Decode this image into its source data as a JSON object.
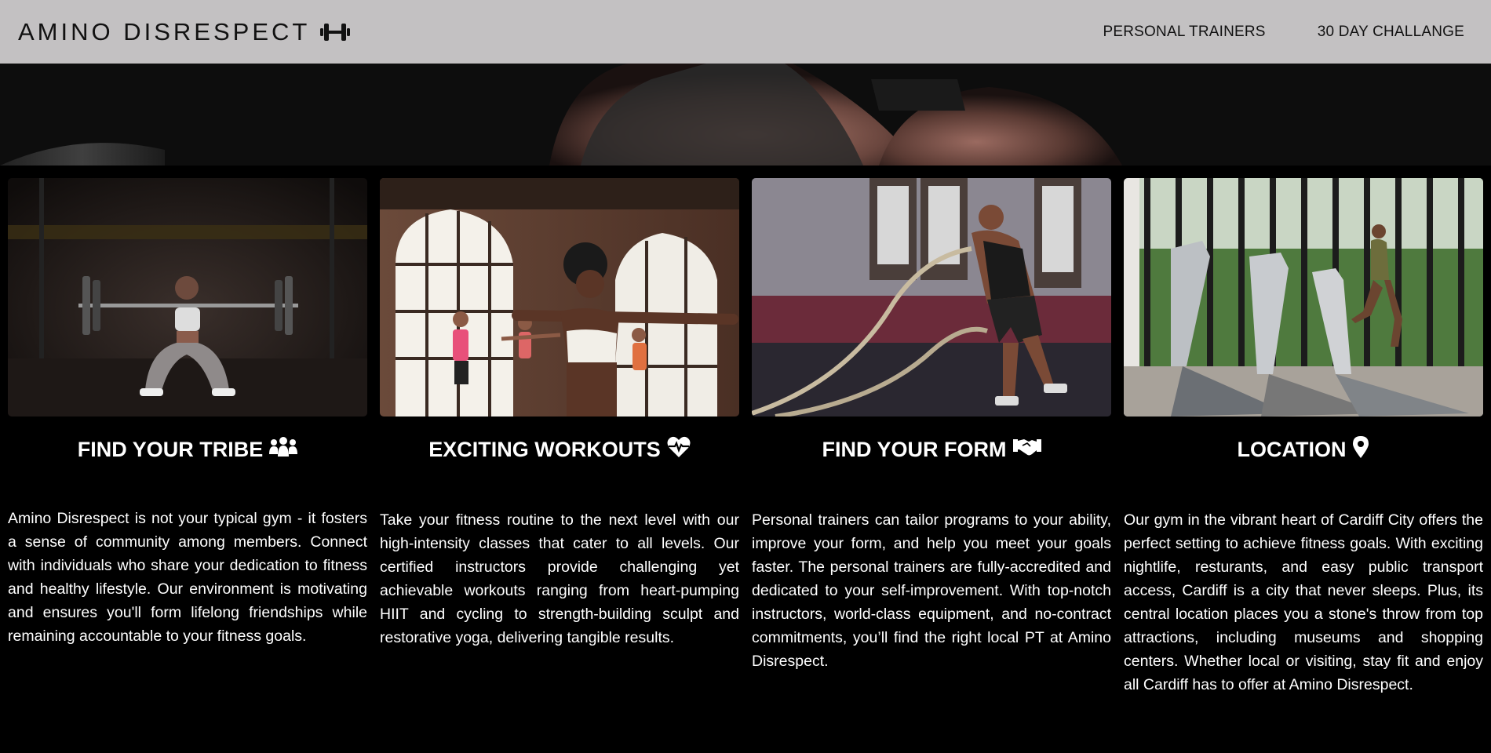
{
  "navbar": {
    "brand": "AMINO DISRESPECT",
    "brand_icon": "dumbbell-icon",
    "links": [
      {
        "label": "PERSONAL TRAINERS"
      },
      {
        "label": "30 DAY CHALLANGE"
      }
    ]
  },
  "hero": {
    "image": "athlete-shoulders-photo"
  },
  "cards": [
    {
      "title": "FIND YOUR TRIBE",
      "icon": "people-group-icon",
      "image": "woman-barbell-squat-photo",
      "text": "Amino Disrespect is not your typical gym - it fosters a sense of community among members. Connect with individuals who share your dedication to fitness and healthy lifestyle. Our environment is motivating and ensures you'll form lifelong friendships while remaining accountable to your fitness goals."
    },
    {
      "title": "EXCITING WORKOUTS",
      "icon": "heart-pulse-icon",
      "image": "group-fitness-class-photo",
      "text": "Take your fitness routine to the next level with our high-intensity classes that cater to all levels. Our certified instructors provide challenging yet achievable workouts ranging from heart-pumping HIIT and cycling to strength-building sculpt and restorative yoga, delivering tangible results."
    },
    {
      "title": "FIND YOUR FORM",
      "icon": "handshake-icon",
      "image": "battle-ropes-photo",
      "text": "Personal trainers can tailor programs to your ability, improve your form, and help you meet your goals faster. The personal trainers are fully-accredited and dedicated to your self-improvement. With top-notch instructors, world-class equipment, and no-contract commitments, you’ll find the right local PT at Amino Disrespect."
    },
    {
      "title": "LOCATION",
      "icon": "location-pin-icon",
      "image": "treadmill-runner-photo",
      "text": "Our gym in the vibrant heart of Cardiff City offers the perfect setting to achieve fitness goals. With exciting nightlife, resturants, and easy public transport access, Cardiff is a city that never sleeps. Plus, its central location places you a stone's throw from top attractions, including museums and shopping centers. Whether local or visiting, stay fit and enjoy all Cardiff has to offer at Amino Disrespect."
    }
  ]
}
